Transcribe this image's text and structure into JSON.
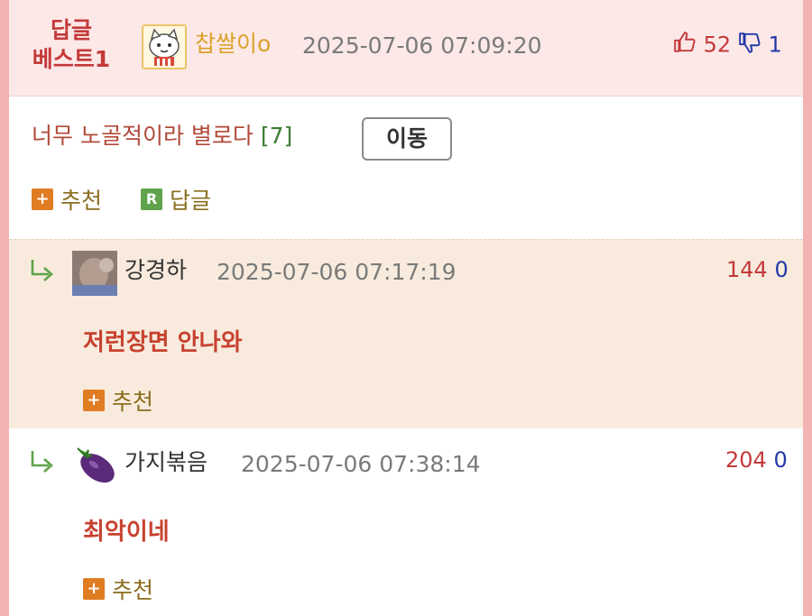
{
  "best": {
    "badge_line1": "답글",
    "badge_line2": "베스트1",
    "nickname": "찹쌀이o",
    "timestamp": "2025-07-06 07:09:20",
    "up_votes": "52",
    "down_votes": "1",
    "text": "너무 노골적이라 별로다",
    "reply_count": "[7]",
    "move_label": "이동",
    "recommend_label": "추천",
    "reply_label": "답글"
  },
  "replies": [
    {
      "nickname": "강경하",
      "timestamp": "2025-07-06 07:17:19",
      "up_votes": "144",
      "down_votes": "0",
      "text": "저런장면 안나와",
      "recommend_label": "추천"
    },
    {
      "nickname": "가지볶음",
      "timestamp": "2025-07-06 07:38:14",
      "up_votes": "204",
      "down_votes": "0",
      "text": "최악이네",
      "recommend_label": "추천"
    }
  ],
  "icons": {
    "plus": "+",
    "reply_square": "R"
  },
  "colors": {
    "best_bg": "#fde8e8",
    "reply_highlight_bg": "#f8ebdd",
    "up_color": "#c43a3a",
    "down_color": "#2238a8",
    "accent_orange": "#e07c22",
    "accent_green": "#5fa34a"
  }
}
